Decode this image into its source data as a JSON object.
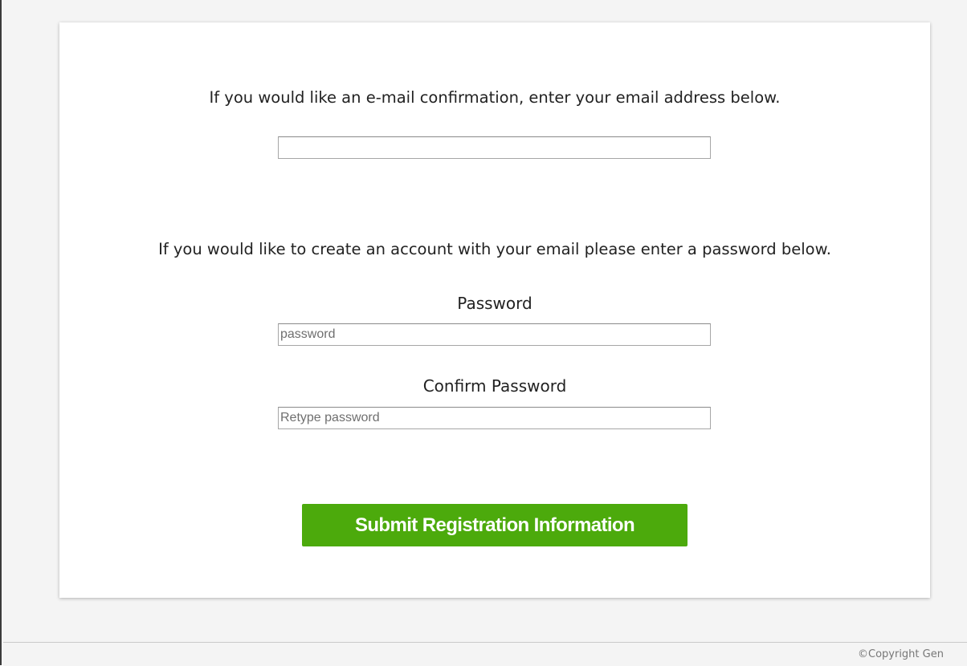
{
  "form": {
    "email_prompt": "If you would like an e-mail confirmation, enter your email address below.",
    "email_value": "",
    "email_placeholder": "",
    "account_prompt": "If you would like to create an account with your email please enter a password below.",
    "password_label": "Password",
    "password_placeholder": "password",
    "confirm_label": "Confirm Password",
    "confirm_placeholder": "Retype password",
    "submit_label": "Submit Registration Information"
  },
  "footer": {
    "copyright": "©Copyright Gen"
  },
  "colors": {
    "submit_button": "#4caa0c",
    "page_background": "#f4f4f4",
    "card_background": "#ffffff"
  }
}
